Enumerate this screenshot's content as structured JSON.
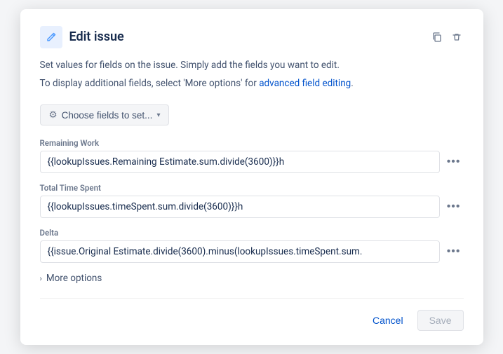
{
  "dialog": {
    "title": "Edit issue",
    "description1": "Set values for fields on the issue. Simply add the fields you want to edit.",
    "description2_before": "To display additional fields, select 'More options' for ",
    "description2_link": "advanced field editing",
    "description2_after": ".",
    "choose_fields_btn": "Choose fields to set...",
    "fields": [
      {
        "label": "Remaining Work",
        "value": "{{lookupIssues.Remaining Estimate.sum.divide(3600)}}h"
      },
      {
        "label": "Total Time Spent",
        "value": "{{lookupIssues.timeSpent.sum.divide(3600)}}h"
      },
      {
        "label": "Delta",
        "value": "{{issue.Original Estimate.divide(3600).minus(lookupIssues.timeSpent.sum."
      }
    ],
    "more_options_label": "More options",
    "cancel_label": "Cancel",
    "save_label": "Save"
  }
}
